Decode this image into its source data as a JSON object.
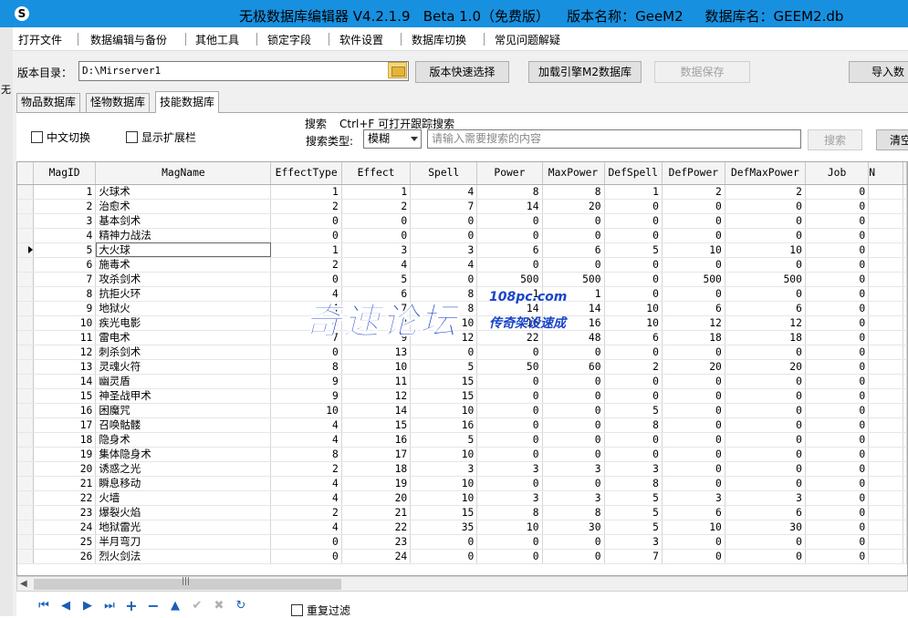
{
  "window": {
    "title": "无极数据库编辑器 V4.2.1.9   Beta 1.0（免费版）    版本名称：GeeM2     数据库名：GEEM2.db",
    "side_glyph": "无"
  },
  "menu": [
    "打开文件",
    "数据编辑与备份",
    "其他工具",
    "锁定字段",
    "软件设置",
    "数据库切换",
    "常见问题解疑"
  ],
  "toolbar": {
    "dir_label": "版本目录：",
    "dir_value": "D:\\Mirserver1",
    "quick_select": "版本快速选择",
    "load_engine": "加载引擎M2数据库",
    "save_data": "数据保存",
    "import": "导入数"
  },
  "tabs": [
    "物品数据库",
    "怪物数据库",
    "技能数据库"
  ],
  "options": {
    "chinese_toggle": "中文切换",
    "show_extend": "显示扩展栏"
  },
  "search": {
    "hint_label": "搜索",
    "hint_shortcut": "Ctrl+F 可打开跟踪搜索",
    "type_label": "搜索类型:",
    "type_value": "模糊",
    "placeholder": "请输入需要搜索的内容",
    "search_button": "搜索",
    "clear_button": "清空"
  },
  "grid": {
    "columns": [
      "MagID",
      "MagName",
      "EffectType",
      "Effect",
      "Spell",
      "Power",
      "MaxPower",
      "DefSpell",
      "DefPower",
      "DefMaxPower",
      "Job",
      "N"
    ],
    "current_row": 5,
    "rows": [
      [
        1,
        "火球术",
        1,
        1,
        4,
        8,
        8,
        1,
        2,
        2,
        0
      ],
      [
        2,
        "治愈术",
        2,
        2,
        7,
        14,
        20,
        0,
        0,
        0,
        0
      ],
      [
        3,
        "基本剑术",
        0,
        0,
        0,
        0,
        0,
        0,
        0,
        0,
        0
      ],
      [
        4,
        "精神力战法",
        0,
        0,
        0,
        0,
        0,
        0,
        0,
        0,
        0
      ],
      [
        5,
        "大火球",
        1,
        3,
        3,
        6,
        6,
        5,
        10,
        10,
        0
      ],
      [
        6,
        "施毒术",
        2,
        4,
        4,
        0,
        0,
        0,
        0,
        0,
        0
      ],
      [
        7,
        "攻杀剑术",
        0,
        5,
        0,
        500,
        500,
        0,
        500,
        500,
        0
      ],
      [
        8,
        "抗拒火环",
        4,
        6,
        8,
        1,
        1,
        0,
        0,
        0,
        0
      ],
      [
        9,
        "地狱火",
        4,
        7,
        8,
        14,
        14,
        10,
        6,
        6,
        0
      ],
      [
        10,
        "疾光电影",
        4,
        8,
        10,
        16,
        16,
        10,
        12,
        12,
        0
      ],
      [
        11,
        "雷电术",
        7,
        9,
        12,
        22,
        48,
        6,
        18,
        18,
        0
      ],
      [
        12,
        "刺杀剑术",
        0,
        13,
        0,
        0,
        0,
        0,
        0,
        0,
        0
      ],
      [
        13,
        "灵魂火符",
        8,
        10,
        5,
        50,
        60,
        2,
        20,
        20,
        0
      ],
      [
        14,
        "幽灵盾",
        9,
        11,
        15,
        0,
        0,
        0,
        0,
        0,
        0
      ],
      [
        15,
        "神圣战甲术",
        9,
        12,
        15,
        0,
        0,
        0,
        0,
        0,
        0
      ],
      [
        16,
        "困魔咒",
        10,
        14,
        10,
        0,
        0,
        5,
        0,
        0,
        0
      ],
      [
        17,
        "召唤骷髅",
        4,
        15,
        16,
        0,
        0,
        8,
        0,
        0,
        0
      ],
      [
        18,
        "隐身术",
        4,
        16,
        5,
        0,
        0,
        0,
        0,
        0,
        0
      ],
      [
        19,
        "集体隐身术",
        8,
        17,
        10,
        0,
        0,
        0,
        0,
        0,
        0
      ],
      [
        20,
        "诱惑之光",
        2,
        18,
        3,
        3,
        3,
        3,
        0,
        0,
        0
      ],
      [
        21,
        "瞬息移动",
        4,
        19,
        10,
        0,
        0,
        8,
        0,
        0,
        0
      ],
      [
        22,
        "火墙",
        4,
        20,
        10,
        3,
        3,
        5,
        3,
        3,
        0
      ],
      [
        23,
        "爆裂火焰",
        2,
        21,
        15,
        8,
        8,
        5,
        6,
        6,
        0
      ],
      [
        24,
        "地狱雷光",
        4,
        22,
        35,
        10,
        30,
        5,
        10,
        30,
        0
      ],
      [
        25,
        "半月弯刀",
        0,
        23,
        0,
        0,
        0,
        3,
        0,
        0,
        0
      ],
      [
        26,
        "烈火剑法",
        0,
        24,
        0,
        0,
        0,
        7,
        0,
        0,
        0
      ]
    ]
  },
  "footer": {
    "repeat_filter": "重复过滤"
  },
  "watermark": {
    "main": "奇速论坛",
    "url": "108pc.com",
    "slogan": "传奇架设速成"
  }
}
